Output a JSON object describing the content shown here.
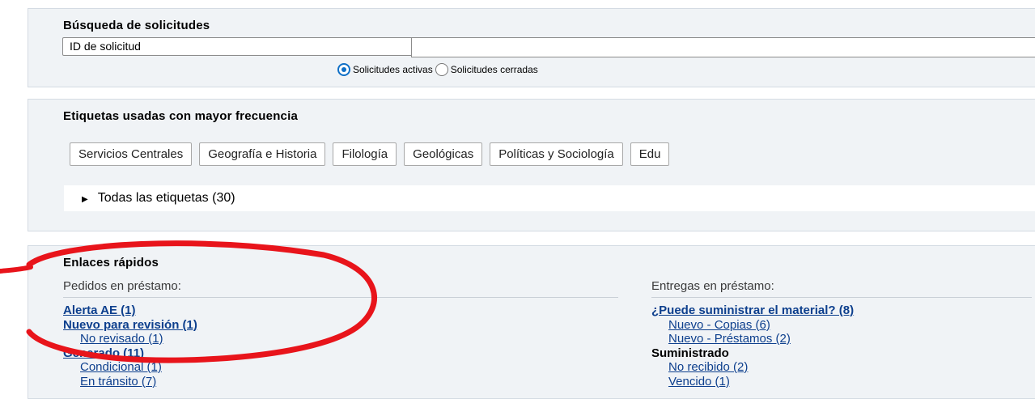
{
  "search": {
    "title": "Búsqueda de solicitudes",
    "select_value": "ID de solicitud",
    "input_value": "",
    "radio_active_label": "Solicitudes activas",
    "radio_closed_label": "Solicitudes cerradas",
    "radio_selected": "Solicitudes activas"
  },
  "tags": {
    "title": "Etiquetas usadas con mayor frecuencia",
    "items": [
      "Servicios Centrales",
      "Geografía e Historia",
      "Filología",
      "Geológicas",
      "Políticas y Sociología",
      "Edu"
    ],
    "all_label": "Todas las etiquetas (30)"
  },
  "links": {
    "title": "Enlaces rápidos",
    "left": {
      "heading": "Pedidos en préstamo:",
      "items": [
        "Alerta AE (1)",
        "Nuevo para revisión (1)",
        "No revisado (1)",
        "Generado (11)",
        "Condicional (1)",
        "En tránsito (7)"
      ]
    },
    "right": {
      "heading": "Entregas en préstamo:",
      "items": [
        "¿Puede suministrar el material? (8)",
        "Nuevo - Copias (6)",
        "Nuevo - Préstamos (2)",
        "Suministrado",
        "No recibido (2)",
        "Vencido (1)"
      ]
    }
  },
  "colors": {
    "panel_bg": "#f0f3f6",
    "link": "#0d3f8d",
    "radio_accent": "#0f6fc6",
    "annotation_red": "#e8141b"
  },
  "icons": [
    "chevron-down-icon",
    "radio-selected-icon",
    "radio-unselected-icon",
    "triangle-right-icon"
  ]
}
